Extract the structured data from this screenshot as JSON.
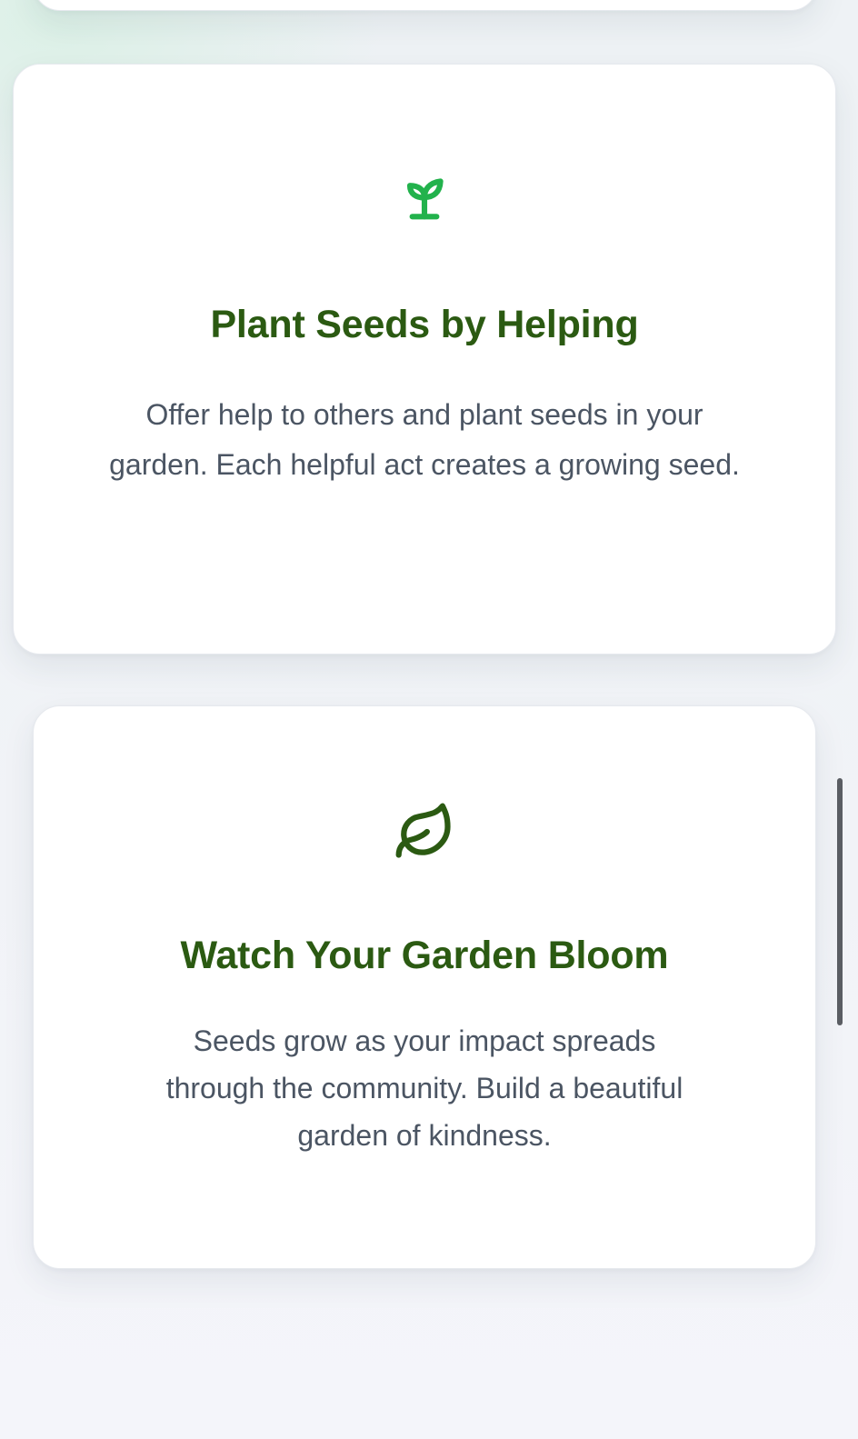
{
  "cards": [
    {
      "icon": "sprout-icon",
      "icon_color": "#22b24c",
      "title": "Plant Seeds by Helping",
      "description": "Offer help to others and plant seeds in your garden. Each helpful act creates a growing seed."
    },
    {
      "icon": "leaf-icon",
      "icon_color": "#2b5a12",
      "title": "Watch Your Garden Bloom",
      "description": "Seeds grow as your impact spreads through the community. Build a beautiful garden of kindness."
    }
  ],
  "colors": {
    "title": "#2b5a12",
    "description": "#4b5563",
    "card_background": "#ffffff"
  }
}
